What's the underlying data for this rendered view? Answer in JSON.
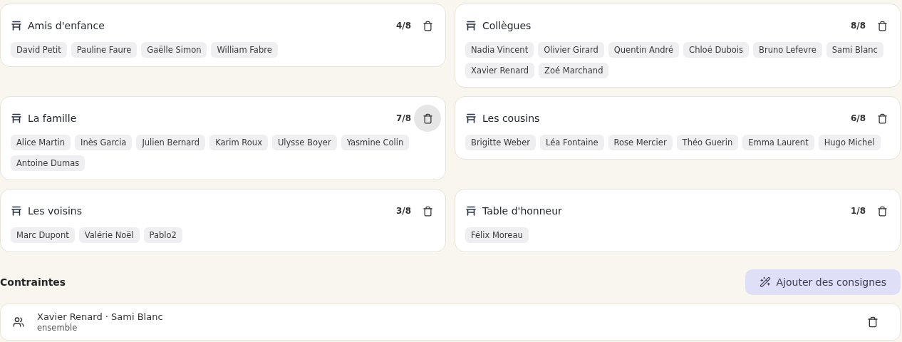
{
  "tables": [
    {
      "name": "Amis d'enfance",
      "count": "4/8",
      "delete_hovered": false,
      "guests": [
        "David Petit",
        "Pauline Faure",
        "Gaëlle Simon",
        "William Fabre"
      ]
    },
    {
      "name": "Collègues",
      "count": "8/8",
      "delete_hovered": false,
      "guests": [
        "Nadia Vincent",
        "Olivier Girard",
        "Quentin André",
        "Chloé Dubois",
        "Bruno Lefevre",
        "Sami Blanc",
        "Xavier Renard",
        "Zoé Marchand"
      ]
    },
    {
      "name": "La famille",
      "count": "7/8",
      "delete_hovered": true,
      "guests": [
        "Alice Martin",
        "Inès Garcia",
        "Julien Bernard",
        "Karim Roux",
        "Ulysse Boyer",
        "Yasmine Colin",
        "Antoine Dumas"
      ]
    },
    {
      "name": "Les cousins",
      "count": "6/8",
      "delete_hovered": false,
      "guests": [
        "Brigitte Weber",
        "Léa Fontaine",
        "Rose Mercier",
        "Théo Guerin",
        "Emma Laurent",
        "Hugo Michel"
      ]
    },
    {
      "name": "Les voisins",
      "count": "3/8",
      "delete_hovered": false,
      "guests": [
        "Marc Dupont",
        "Valérie Noël",
        "Pablo2"
      ]
    },
    {
      "name": "Table d'honneur",
      "count": "1/8",
      "delete_hovered": false,
      "guests": [
        "Félix Moreau"
      ]
    }
  ],
  "constraints": {
    "title": "Contraintes",
    "add_button": "Ajouter des consignes",
    "items": [
      {
        "people": "Xavier Renard · Sami Blanc",
        "type": "ensemble"
      }
    ]
  }
}
